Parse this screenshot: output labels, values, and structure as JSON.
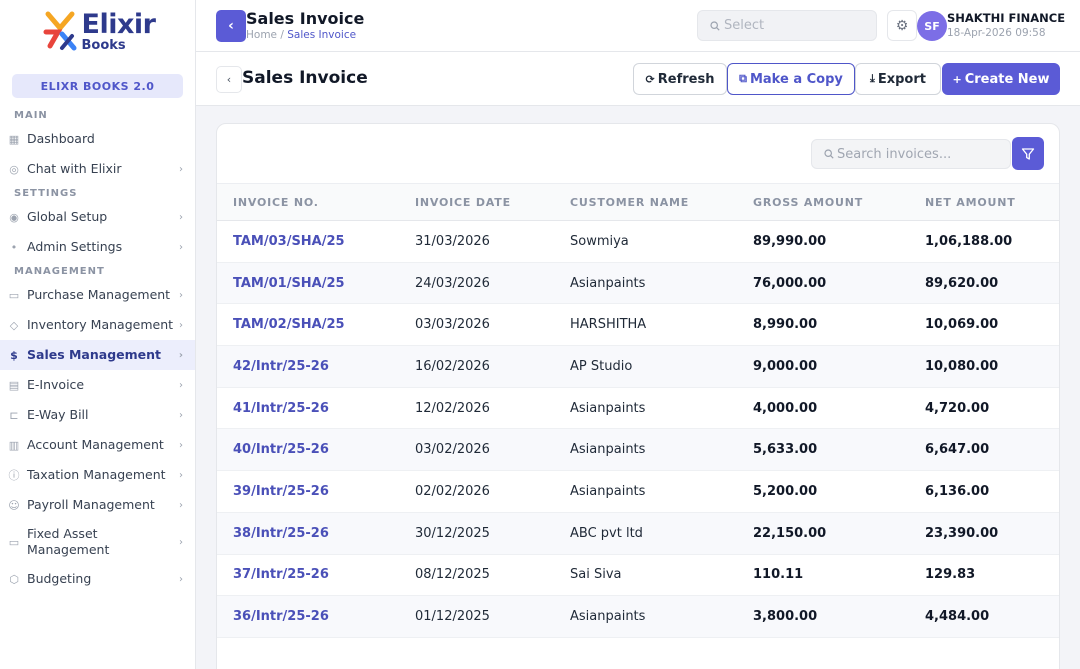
{
  "brand": {
    "name": "Elixir",
    "sub": "Books",
    "version": "ELIXR BOOKS 2.0"
  },
  "sidebar": {
    "sections": [
      {
        "label": "MAIN",
        "items": [
          {
            "label": "Dashboard",
            "icon": "grid-icon",
            "chevron": false
          },
          {
            "label": "Chat with Elixir",
            "icon": "chat-icon",
            "chevron": true
          }
        ]
      },
      {
        "label": "SETTINGS",
        "items": [
          {
            "label": "Global Setup",
            "icon": "broadcast-icon",
            "chevron": true
          },
          {
            "label": "Admin Settings",
            "icon": "dot-icon",
            "chevron": true
          }
        ]
      },
      {
        "label": "MANAGEMENT",
        "items": [
          {
            "label": "Purchase Management",
            "icon": "clipboard-icon",
            "chevron": true
          },
          {
            "label": "Inventory Management",
            "icon": "tag-icon",
            "chevron": true
          },
          {
            "label": "Sales Management",
            "icon": "dollar-icon",
            "chevron": true,
            "active": true
          },
          {
            "label": "E-Invoice",
            "icon": "card-icon",
            "chevron": true
          },
          {
            "label": "E-Way Bill",
            "icon": "truck-icon",
            "chevron": true
          },
          {
            "label": "Account Management",
            "icon": "ledger-icon",
            "chevron": true
          },
          {
            "label": "Taxation Management",
            "icon": "info-icon",
            "chevron": true
          },
          {
            "label": "Payroll Management",
            "icon": "user-icon",
            "chevron": true
          },
          {
            "label": "Fixed Asset Management",
            "icon": "monitor-icon",
            "chevron": true
          },
          {
            "label": "Budgeting",
            "icon": "hexagon-icon",
            "chevron": true
          }
        ]
      }
    ]
  },
  "topbar": {
    "title": "Sales Invoice",
    "breadcrumb_home": "Home",
    "breadcrumb_sep": " / ",
    "breadcrumb_current": "Sales Invoice",
    "select_placeholder": "Select",
    "avatar_initials": "SF",
    "company": "SHAKTHI FINANCE",
    "datetime": "18-Apr-2026 09:58"
  },
  "page": {
    "title": "Sales Invoice",
    "actions": {
      "refresh": "Refresh",
      "copy": "Make a Copy",
      "export": "Export",
      "create": "Create New"
    },
    "search_placeholder": "Search invoices..."
  },
  "table": {
    "columns": [
      "INVOICE NO.",
      "INVOICE DATE",
      "CUSTOMER NAME",
      "GROSS AMOUNT",
      "NET AMOUNT"
    ],
    "rows": [
      [
        "TAM/03/SHA/25",
        "31/03/2026",
        "Sowmiya",
        "89,990.00",
        "1,06,188.00"
      ],
      [
        "TAM/01/SHA/25",
        "24/03/2026",
        "Asianpaints",
        "76,000.00",
        "89,620.00"
      ],
      [
        "TAM/02/SHA/25",
        "03/03/2026",
        "HARSHITHA",
        "8,990.00",
        "10,069.00"
      ],
      [
        "42/Intr/25-26",
        "16/02/2026",
        "AP Studio",
        "9,000.00",
        "10,080.00"
      ],
      [
        "41/Intr/25-26",
        "12/02/2026",
        "Asianpaints",
        "4,000.00",
        "4,720.00"
      ],
      [
        "40/Intr/25-26",
        "03/02/2026",
        "Asianpaints",
        "5,633.00",
        "6,647.00"
      ],
      [
        "39/Intr/25-26",
        "02/02/2026",
        "Asianpaints",
        "5,200.00",
        "6,136.00"
      ],
      [
        "38/Intr/25-26",
        "30/12/2025",
        "ABC pvt ltd",
        "22,150.00",
        "23,390.00"
      ],
      [
        "37/Intr/25-26",
        "08/12/2025",
        "Sai Siva",
        "110.11",
        "129.83"
      ],
      [
        "36/Intr/25-26",
        "01/12/2025",
        "Asianpaints",
        "3,800.00",
        "4,484.00"
      ]
    ]
  },
  "colors": {
    "accent": "#5b5bd6",
    "brand_navy": "#2e3a8c",
    "link": "#4a50b8"
  }
}
